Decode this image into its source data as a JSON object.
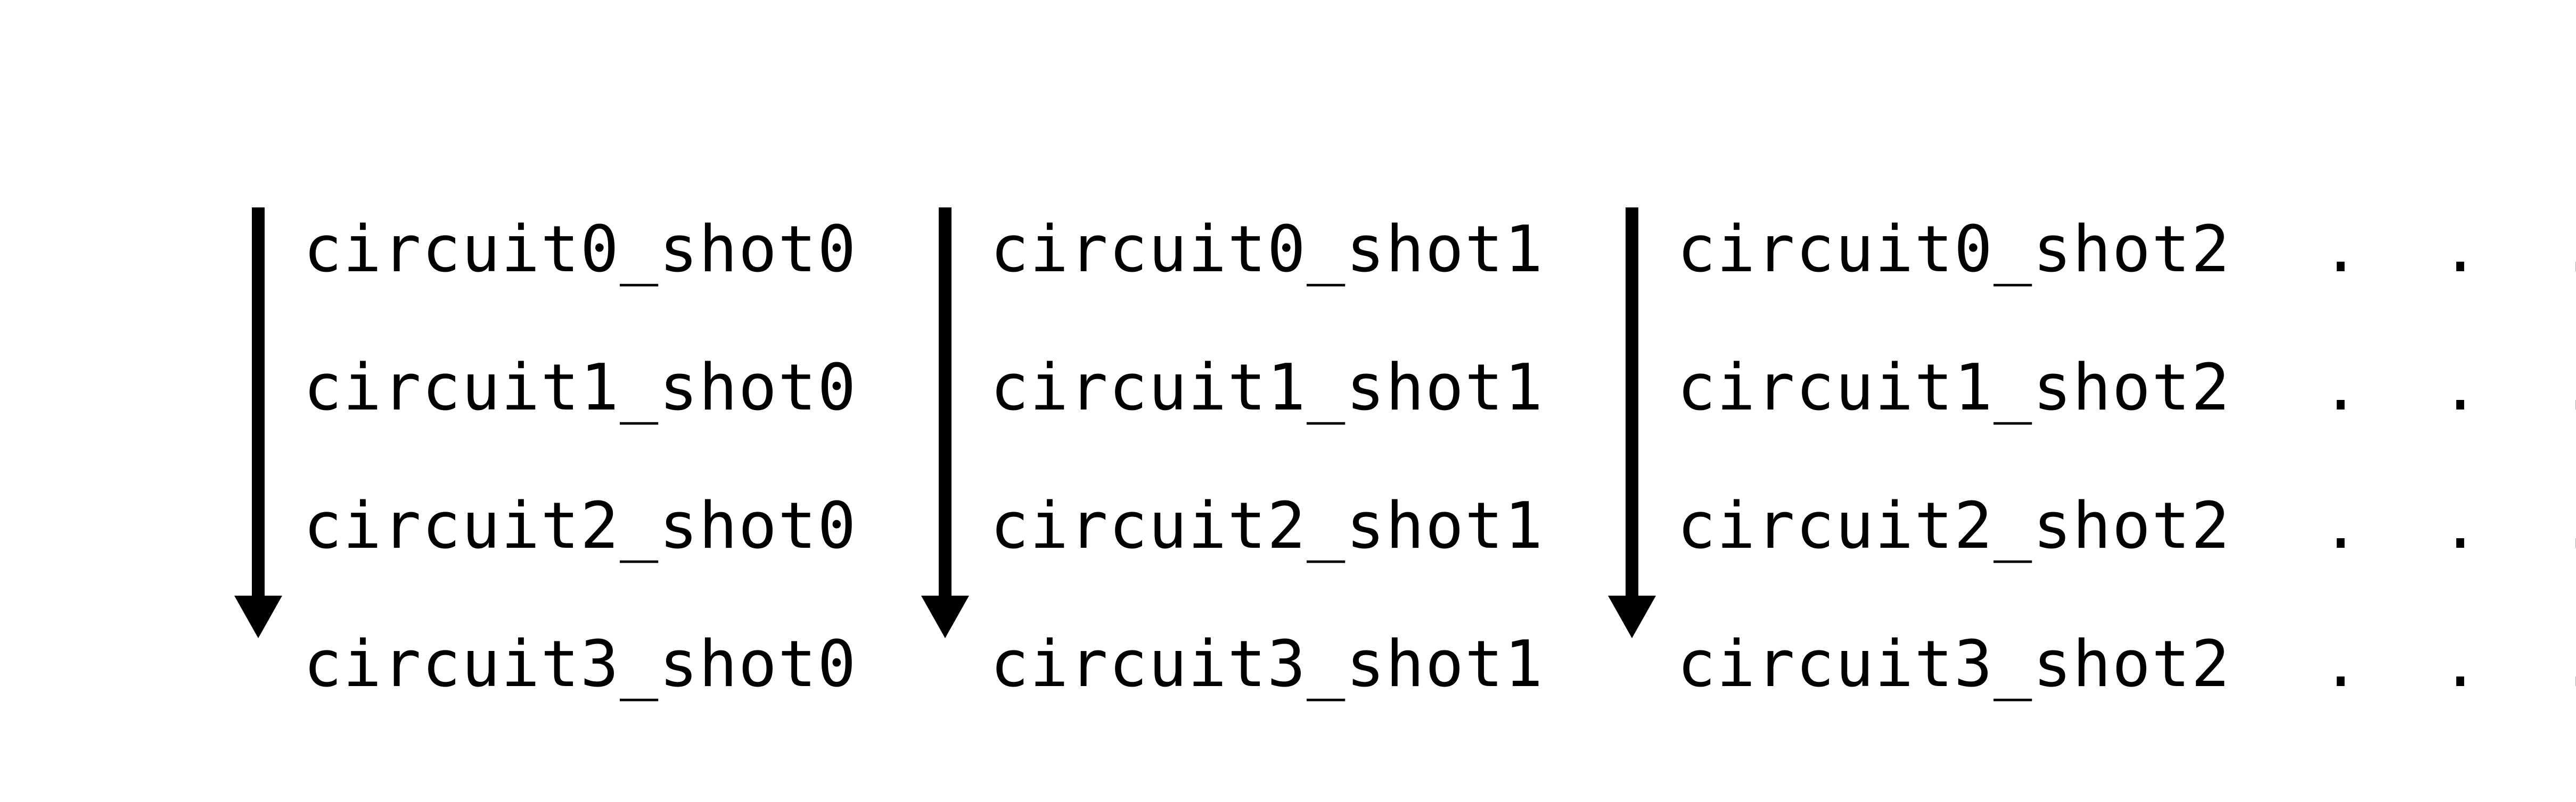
{
  "columns": [
    {
      "rows": [
        "circuit0_shot0",
        "circuit1_shot0",
        "circuit2_shot0",
        "circuit3_shot0"
      ]
    },
    {
      "rows": [
        "circuit0_shot1",
        "circuit1_shot1",
        "circuit2_shot1",
        "circuit3_shot1"
      ]
    },
    {
      "rows": [
        "circuit0_shot2",
        "circuit1_shot2",
        "circuit2_shot2",
        "circuit3_shot2"
      ]
    }
  ],
  "ellipsis": {
    "rows": [
      ". . .",
      ". . .",
      ". . .",
      ". . ."
    ]
  },
  "arrow_glyph": "↓"
}
